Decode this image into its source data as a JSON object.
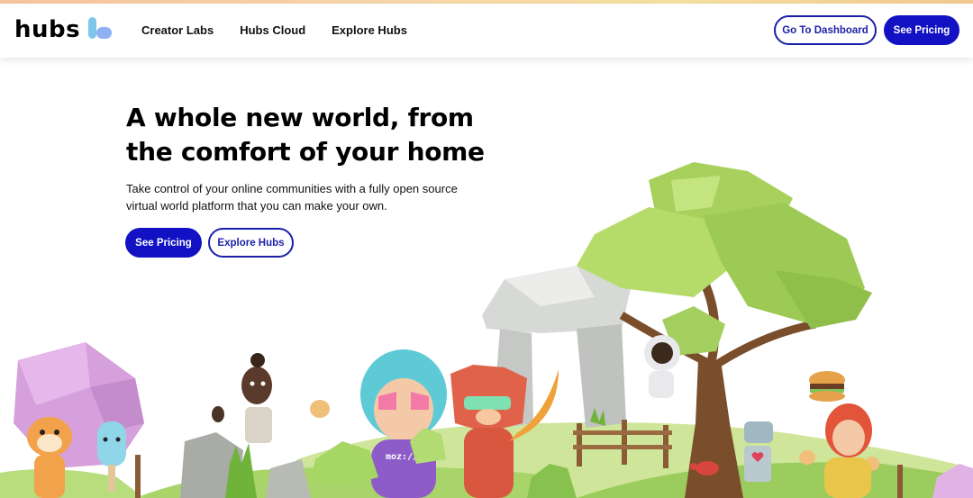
{
  "brand": {
    "name": "hubs"
  },
  "nav": {
    "items": [
      {
        "label": "Creator Labs"
      },
      {
        "label": "Hubs Cloud"
      },
      {
        "label": "Explore Hubs"
      }
    ]
  },
  "header_actions": {
    "dashboard_label": "Go To Dashboard",
    "pricing_label": "See Pricing"
  },
  "hero": {
    "title_line1": "A whole new world, from",
    "title_line2": "the comfort of your home",
    "subtitle_line1": "Take control of your online communities with a fully open source",
    "subtitle_line2": "virtual world platform that you can make your own.",
    "primary_label": "See Pricing",
    "secondary_label": "Explore Hubs"
  },
  "illustration": {
    "shirt_text": "moz://a"
  },
  "colors": {
    "accent": "#1211c4",
    "outline": "#1b1fa8",
    "logo_bar": "#7fc6ea",
    "logo_dot": "#8fb0f2"
  }
}
